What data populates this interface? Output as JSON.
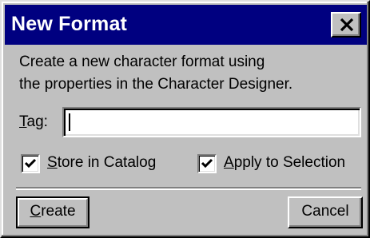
{
  "window": {
    "title": "New Format",
    "close_icon": "close-icon"
  },
  "description": {
    "line1": "Create a new character format using",
    "line2": "the properties in the Character Designer."
  },
  "tag": {
    "label_mnemonic": "T",
    "label_rest": "ag:",
    "value": ""
  },
  "options": {
    "store_in_catalog": {
      "mnemonic": "S",
      "rest": "tore in Catalog",
      "checked": true
    },
    "apply_to_selection": {
      "mnemonic": "A",
      "rest": "pply to Selection",
      "checked": true
    }
  },
  "buttons": {
    "create": {
      "mnemonic": "C",
      "rest": "reate"
    },
    "cancel": {
      "label": "Cancel"
    }
  },
  "colors": {
    "titlebar": "#000080",
    "face": "#c0c0c0"
  }
}
